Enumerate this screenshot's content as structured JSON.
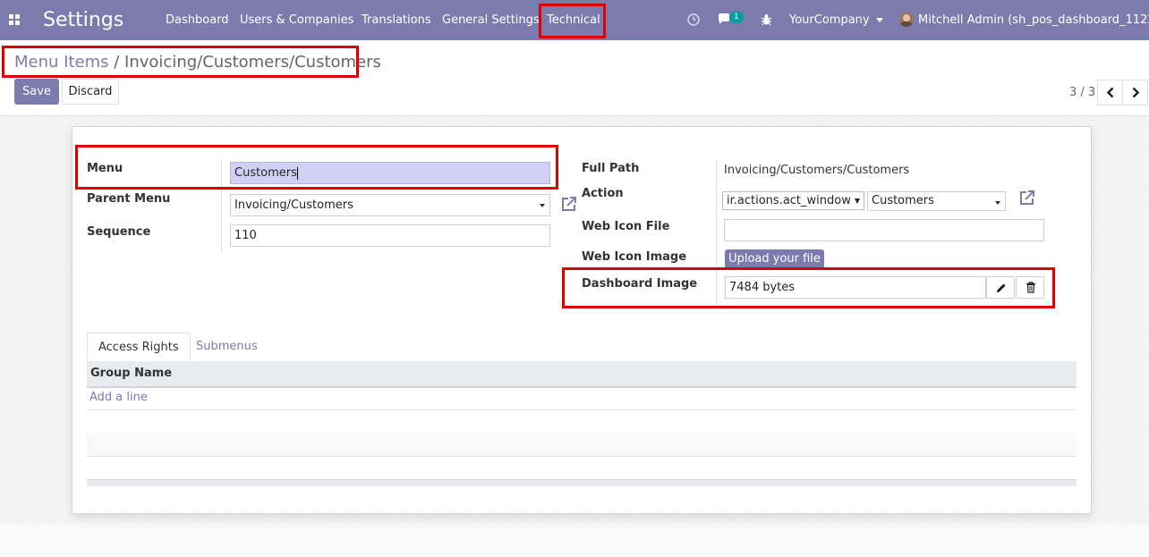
{
  "navbar": {
    "app_title": "Settings",
    "menu": [
      "Dashboard",
      "Users & Companies",
      "Translations",
      "General Settings",
      "Technical"
    ],
    "messages_badge": "1",
    "company": "YourCompany",
    "user": "Mitchell Admin (sh_pos_dashboard_1122)",
    "colors": {
      "background": "#7c7bad",
      "badge": "#00a09d"
    },
    "icons": [
      "apps-grid-icon",
      "clock-icon",
      "chat-icon",
      "bug-icon",
      "avatar"
    ]
  },
  "breadcrumb": {
    "parent": "Menu Items",
    "separator": "/",
    "current": "Invoicing/Customers/Customers"
  },
  "buttons": {
    "save": "Save",
    "discard": "Discard",
    "upload": "Upload your file"
  },
  "pager": {
    "value": "3 / 3"
  },
  "form": {
    "left": {
      "menu_label": "Menu",
      "menu_value": "Customers",
      "parent_label": "Parent Menu",
      "parent_value": "Invoicing/Customers",
      "sequence_label": "Sequence",
      "sequence_value": "110"
    },
    "right": {
      "full_path_label": "Full Path",
      "full_path_value": "Invoicing/Customers/Customers",
      "action_label": "Action",
      "action_type": "ir.actions.act_window",
      "action_value": "Customers",
      "web_icon_file_label": "Web Icon File",
      "web_icon_file_value": "",
      "web_icon_image_label": "Web Icon Image",
      "dashboard_image_label": "Dashboard Image",
      "dashboard_image_value": "7484 bytes"
    }
  },
  "tabs": {
    "access_rights": "Access Rights",
    "submenus": "Submenus"
  },
  "table": {
    "column": "Group Name",
    "add_line": "Add a line"
  }
}
